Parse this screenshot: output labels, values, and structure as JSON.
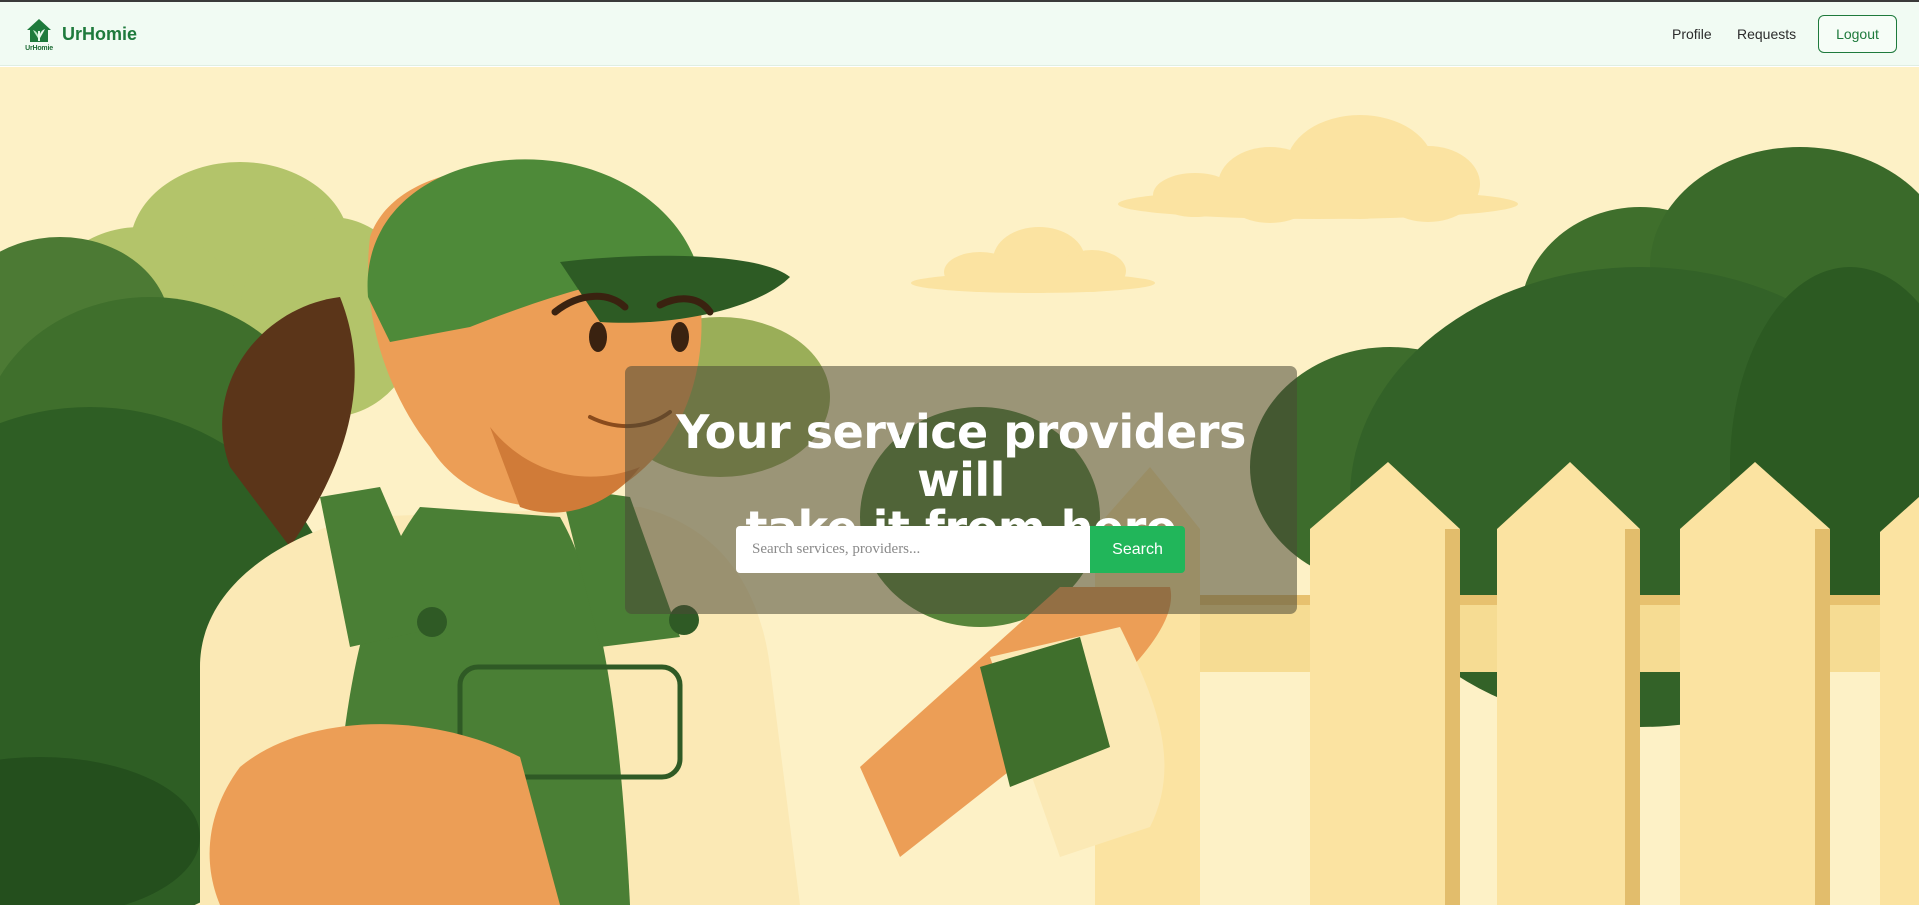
{
  "navbar": {
    "logo_icon": "house-leaf-icon",
    "logo_caption": "UrHomie",
    "brand": "UrHomie",
    "links": {
      "profile": "Profile",
      "requests": "Requests"
    },
    "logout_label": "Logout"
  },
  "hero": {
    "illustration": "gardener-painting-fence",
    "title_line1": "Your service providers will",
    "title_line2": "take it from here",
    "search": {
      "placeholder": "Search services, providers...",
      "value": "",
      "button_label": "Search"
    }
  },
  "colors": {
    "brand_green": "#1e7a3c",
    "search_button": "#21b65a",
    "nav_bg": "#f1fbf3",
    "hero_sky": "#fdf0c4"
  }
}
